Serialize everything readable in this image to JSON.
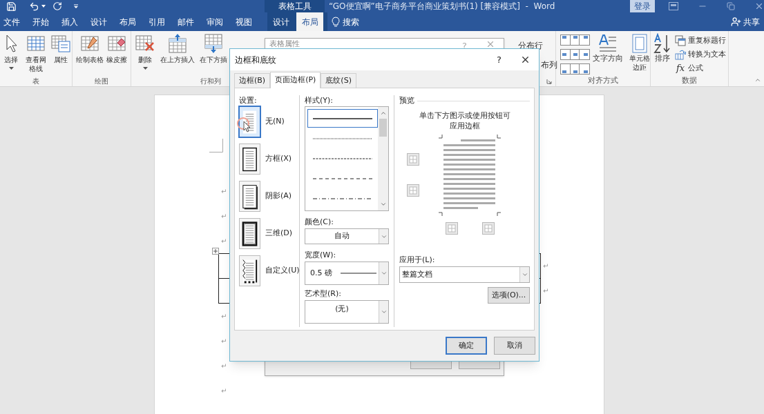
{
  "title_bar": {
    "tool_context": "表格工具",
    "title": "“GO便宜啊”电子商务平台商业策划书(1) [兼容模式]  -  Word",
    "sign_in_button": "登录"
  },
  "ribbon_tabs": [
    {
      "label": "文件",
      "selected": false,
      "contextual": false
    },
    {
      "label": "开始",
      "selected": false,
      "contextual": false
    },
    {
      "label": "插入",
      "selected": false,
      "contextual": false
    },
    {
      "label": "设计",
      "selected": false,
      "contextual": false
    },
    {
      "label": "布局",
      "selected": false,
      "contextual": false
    },
    {
      "label": "引用",
      "selected": false,
      "contextual": false
    },
    {
      "label": "邮件",
      "selected": false,
      "contextual": false
    },
    {
      "label": "审阅",
      "selected": false,
      "contextual": false
    },
    {
      "label": "视图",
      "selected": false,
      "contextual": false
    },
    {
      "label": "设计",
      "selected": false,
      "contextual": true
    },
    {
      "label": "布局",
      "selected": true,
      "contextual": true
    }
  ],
  "search": {
    "label": "搜索"
  },
  "share_button": "共享",
  "ribbon_left_groups": [
    {
      "label": "表",
      "buttons": [
        {
          "kind": "select",
          "label": "选择",
          "dropdown": true
        },
        {
          "kind": "gridlines",
          "label": "查看网格线",
          "dropdown": false
        },
        {
          "kind": "properties",
          "label": "属性",
          "dropdown": false
        }
      ]
    },
    {
      "label": "绘图",
      "buttons": [
        {
          "kind": "draw-table",
          "label": "绘制表格",
          "dropdown": false
        },
        {
          "kind": "eraser",
          "label": "橡皮擦",
          "dropdown": false
        }
      ]
    },
    {
      "label": "行和列",
      "buttons": [
        {
          "kind": "delete",
          "label": "删除",
          "dropdown": true
        },
        {
          "kind": "insert-above",
          "label": "在上方插入",
          "dropdown": false
        },
        {
          "kind": "insert-below",
          "label": "在下方插",
          "dropdown": false
        }
      ]
    }
  ],
  "distribute_fragments": [
    "分布行",
    "布列"
  ],
  "alignment_group": {
    "label": "对齐方式",
    "text_direction": "文字方向",
    "cell_margins": "单元格边距"
  },
  "data_group": {
    "label": "数据",
    "sort": "排序",
    "commands": [
      {
        "kind": "repeat-header",
        "label": "重复标题行"
      },
      {
        "kind": "convert",
        "label": "转换为文本"
      },
      {
        "kind": "formula",
        "label": "公式",
        "symbol": "fx"
      }
    ]
  },
  "document": {
    "marks_before_table": [
      "↵",
      "↵",
      "↵"
    ],
    "table_row_marks": [
      "↵",
      "↵"
    ],
    "marks_after_table": [
      "↵",
      "↵",
      "↵",
      "↵"
    ]
  },
  "back_dialog": {
    "title": "表格属性",
    "help": "?"
  },
  "dialog": {
    "title": "边框和底纹",
    "help": "?",
    "tabs": [
      {
        "label": "边框(B)",
        "selected": false
      },
      {
        "label": "页面边框(P)",
        "selected": true
      },
      {
        "label": "底纹(S)",
        "selected": false
      }
    ],
    "settings_label": "设置:",
    "settings": [
      {
        "kind": "none",
        "label": "无(N)",
        "selected": true
      },
      {
        "kind": "box",
        "label": "方框(X)",
        "selected": false
      },
      {
        "kind": "shadow",
        "label": "阴影(A)",
        "selected": false
      },
      {
        "kind": "three-d",
        "label": "三维(D)",
        "selected": false
      },
      {
        "kind": "custom",
        "label": "自定义(U)",
        "selected": false
      }
    ],
    "style_label": "样式(Y):",
    "styles": [
      {
        "kind": "solid",
        "selected": true
      },
      {
        "kind": "dotted",
        "selected": false
      },
      {
        "kind": "dense-dash",
        "selected": false
      },
      {
        "kind": "dash",
        "selected": false
      },
      {
        "kind": "dash-dot",
        "selected": false
      }
    ],
    "color_label": "颜色(C):",
    "color_value": "自动",
    "width_label": "宽度(W):",
    "width_value": "0.5 磅",
    "art_label": "艺术型(R):",
    "art_value": "(无)",
    "preview_label": "预览",
    "preview_hint": "单击下方图示或使用按钮可应用边框",
    "apply_label": "应用于(L):",
    "apply_value": "整篇文档",
    "options_button": "选项(O)...",
    "ok_button": "确定",
    "cancel_button": "取消"
  }
}
